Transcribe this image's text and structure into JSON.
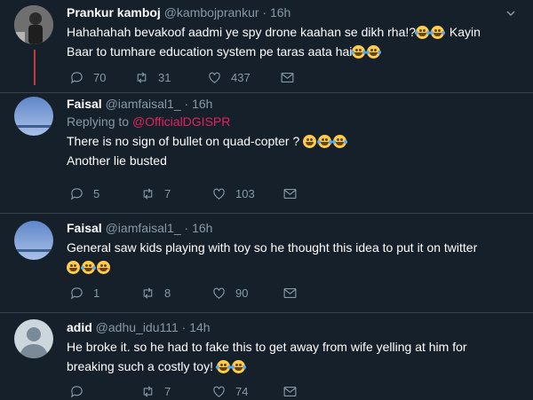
{
  "tweets": [
    {
      "name": "Prankur kamboj",
      "handle": "@kambojprankur",
      "time": "16h",
      "replying_to": "",
      "lines": [
        "Hahahahah bevakoof  aadmi ye spy drone kaahan se dikh rha!?",
        " Kayin",
        "Baar to tumhare education system pe taras aata hai"
      ],
      "replies": "70",
      "retweets": "31",
      "likes": "437"
    },
    {
      "name": "Faisal",
      "handle": "@iamfaisal1_",
      "time": "16h",
      "replying_label": "Replying to",
      "replying_to": "@OfficialDGISPR",
      "lines": [
        "There is no sign of bullet on quad-copter ?",
        "Another lie busted"
      ],
      "replies": "5",
      "retweets": "7",
      "likes": "103"
    },
    {
      "name": "Faisal",
      "handle": "@iamfaisal1_",
      "time": "16h",
      "replying_to": "",
      "lines": [
        "General saw kids playing with toy so he thought this idea to put it on twitter"
      ],
      "replies": "1",
      "retweets": "8",
      "likes": "90"
    },
    {
      "name": "adid",
      "handle": "@adhu_idu111",
      "time": "14h",
      "replying_to": "",
      "lines": [
        "He broke it. so he had to  fake this to get away from wife yelling at him for",
        "breaking such a costly toy!"
      ],
      "replies": "",
      "retweets": "7",
      "likes": "74"
    }
  ],
  "separator": "·",
  "icons": [
    "reply-icon",
    "retweet-icon",
    "like-icon",
    "message-icon",
    "chevron-down-icon"
  ],
  "colors": {
    "background": "#15202b",
    "thread_line": "#c23a3a",
    "mention": "#e0245e",
    "muted": "#8899a6"
  }
}
